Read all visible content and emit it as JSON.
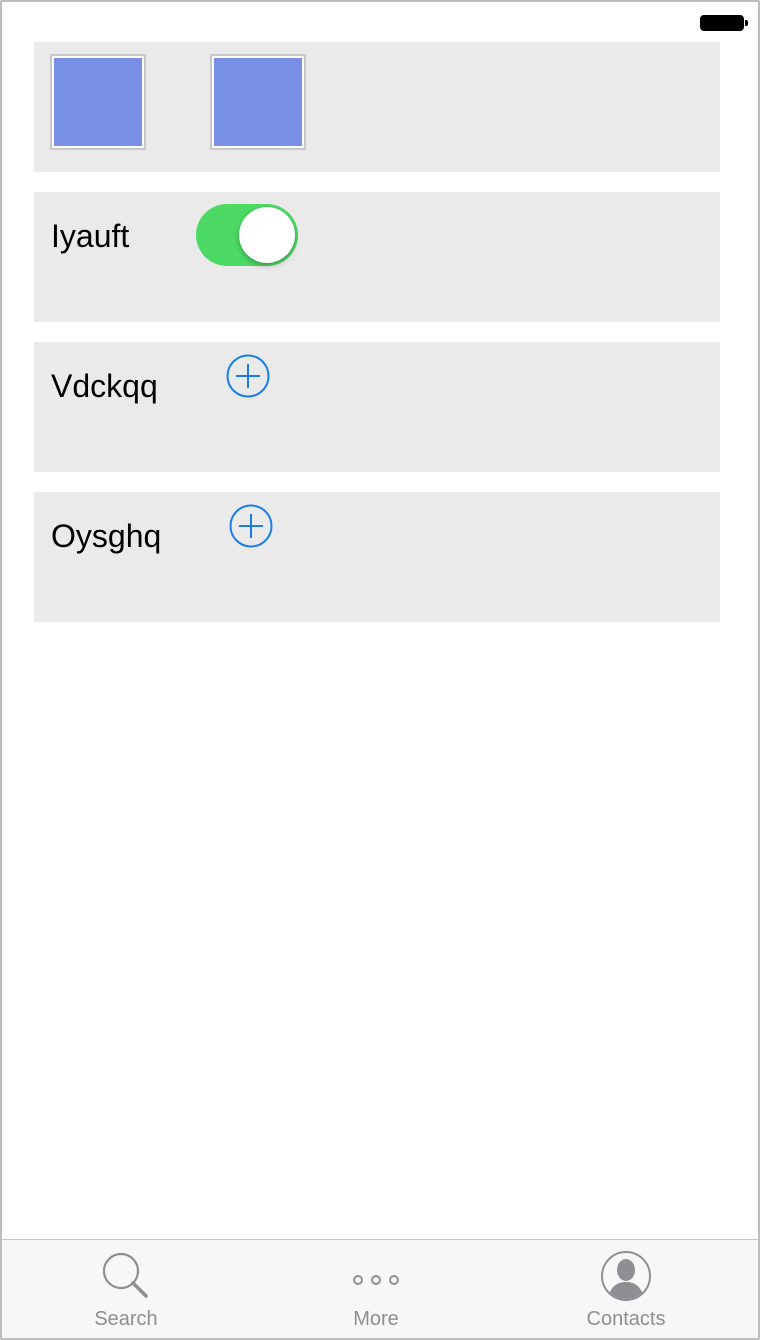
{
  "status_bar": {
    "battery_icon": "battery-full-icon"
  },
  "rows": [
    {
      "type": "images",
      "icon": "image-thumbnail-icon"
    },
    {
      "type": "toggle",
      "label": "Iyauft",
      "toggle_on": true,
      "accent": "#4cd964"
    },
    {
      "type": "add",
      "label": "Vdckqq",
      "icon": "plus-circle-icon",
      "accent": "#1a7ee6"
    },
    {
      "type": "add",
      "label": "Oysghq",
      "icon": "plus-circle-icon",
      "accent": "#1a7ee6"
    }
  ],
  "tab_bar": {
    "tabs": [
      {
        "label": "Search",
        "icon": "search-icon"
      },
      {
        "label": "More",
        "icon": "more-icon"
      },
      {
        "label": "Contacts",
        "icon": "contacts-icon"
      }
    ]
  }
}
